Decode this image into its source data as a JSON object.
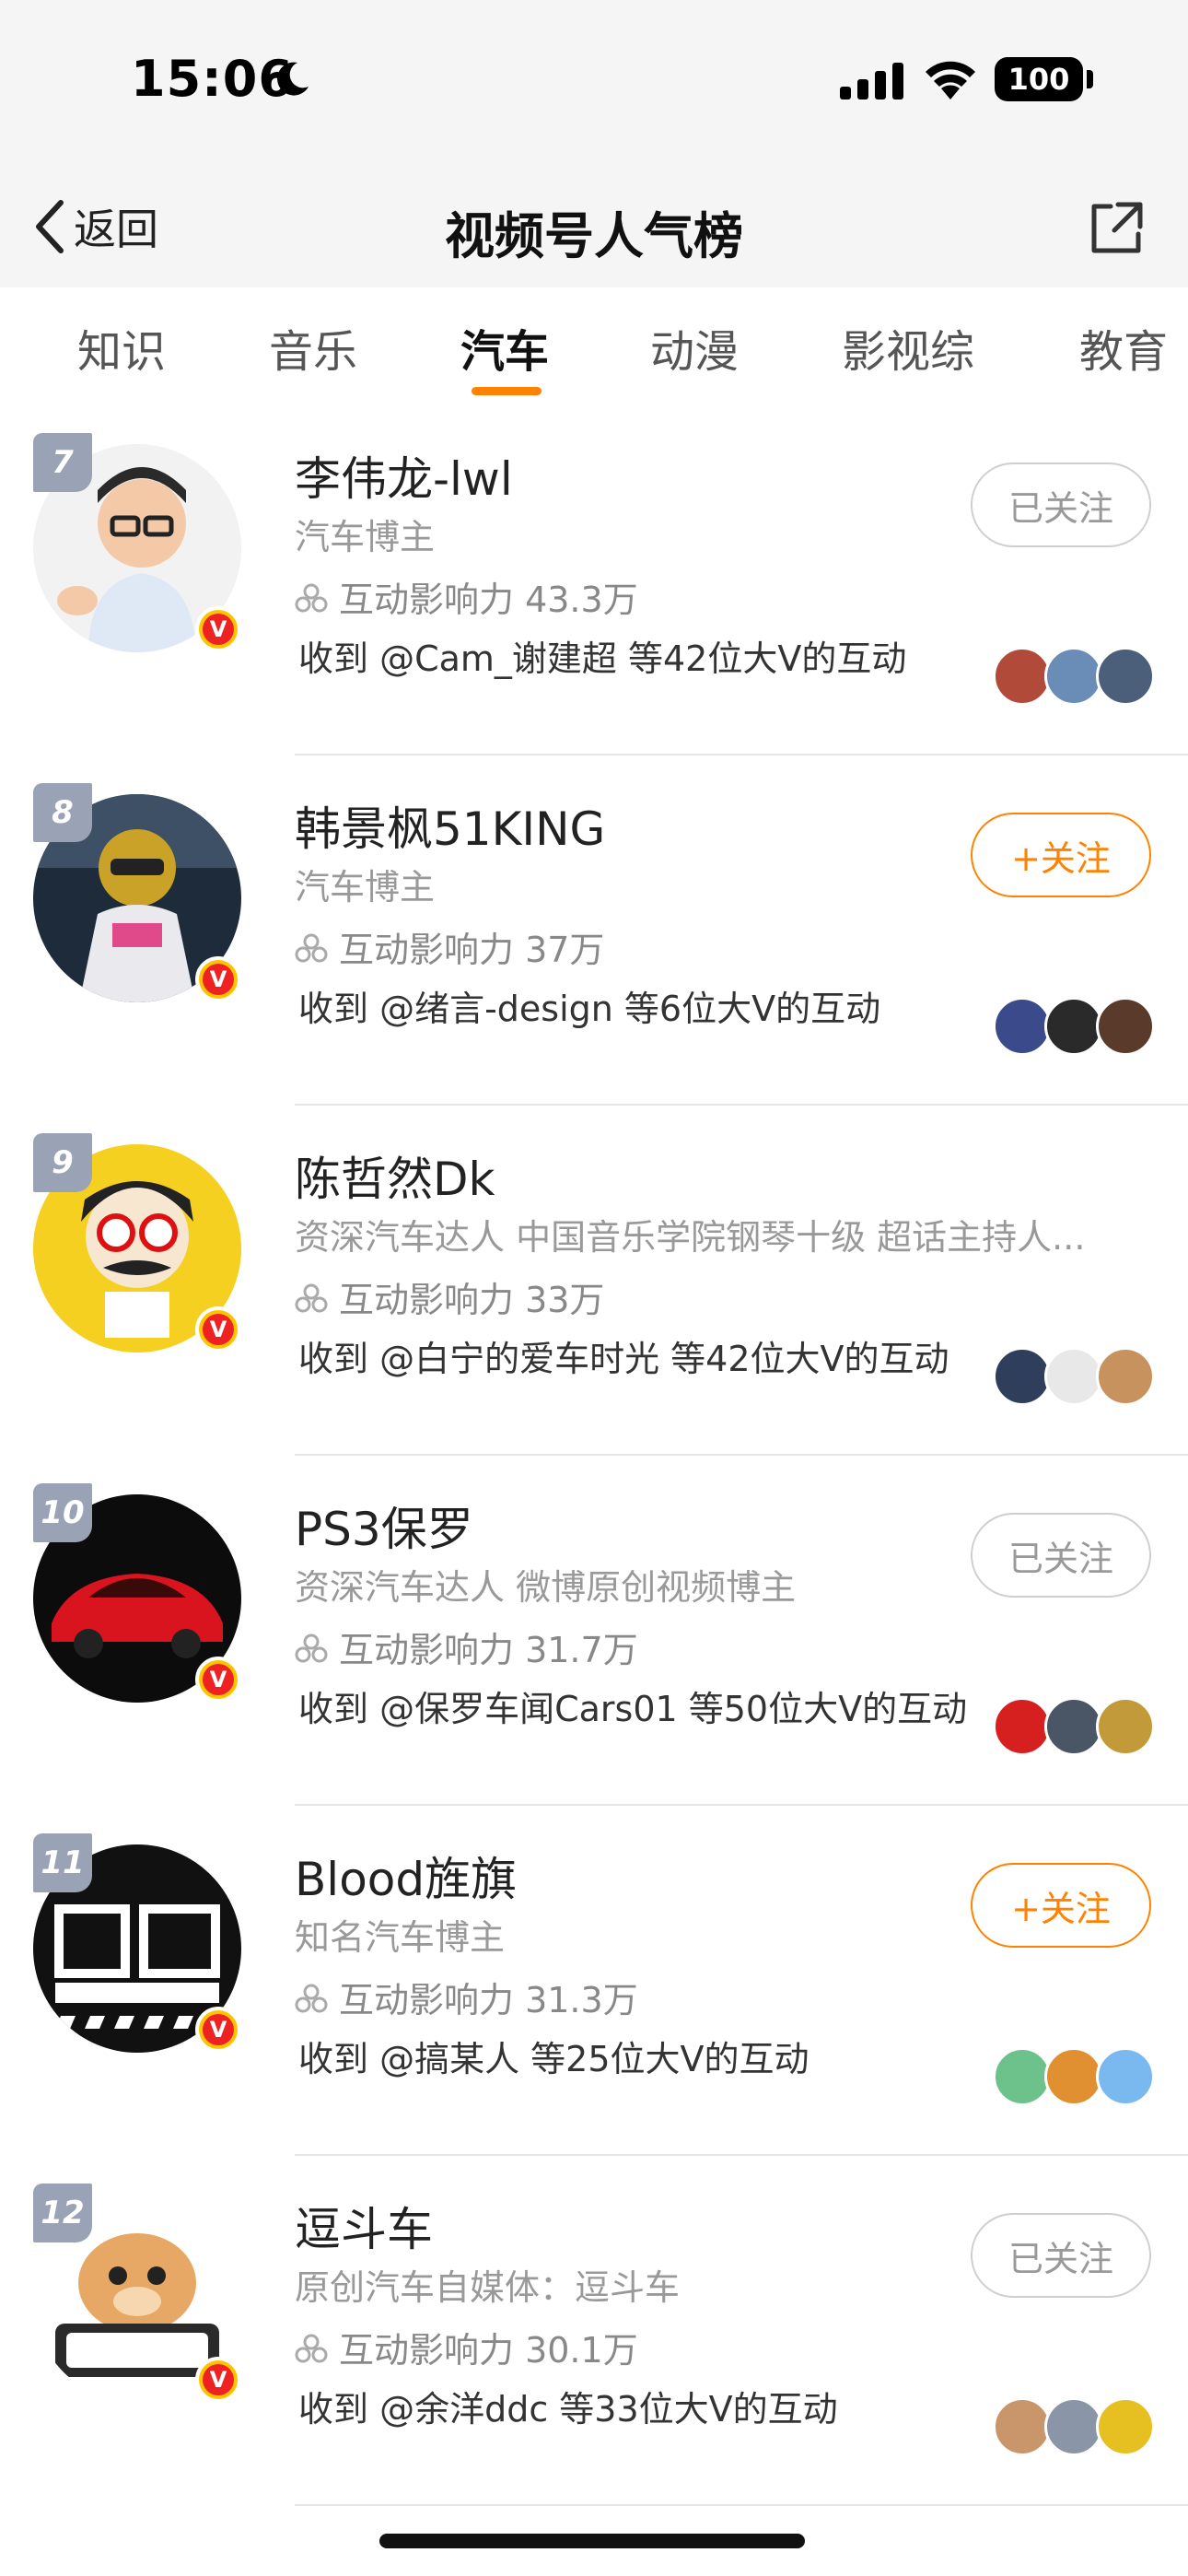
{
  "status_bar": {
    "time": "15:06",
    "battery": "100"
  },
  "nav": {
    "back_label": "返回",
    "title": "视频号人气榜"
  },
  "tabs": [
    {
      "label": "知识",
      "active": false
    },
    {
      "label": "音乐",
      "active": false
    },
    {
      "label": "汽车",
      "active": true
    },
    {
      "label": "动漫",
      "active": false
    },
    {
      "label": "影视综",
      "active": false
    },
    {
      "label": "教育",
      "active": false
    }
  ],
  "colors": {
    "accent": "#ff8200",
    "rank_badge": "#9aa3b6",
    "verified": "#ee2222"
  },
  "rows": [
    {
      "rank": "7",
      "name": "李伟龙-lwl",
      "desc": "汽车博主",
      "influence": "互动影响力 43.3万",
      "received": "收到 @Cam_谢建超 等42位大V的互动",
      "button": "已关注",
      "followed": true
    },
    {
      "rank": "8",
      "name": "韩景枫51KING",
      "desc": "汽车博主",
      "influence": "互动影响力 37万",
      "received": "收到 @绪言-design 等6位大V的互动",
      "button": "+关注",
      "followed": false
    },
    {
      "rank": "9",
      "name": "陈哲然Dk",
      "desc": "资深汽车达人 中国音乐学院钢琴十级 超话主持人...",
      "influence": "互动影响力 33万",
      "received": "收到 @白宁的爱车时光 等42位大V的互动",
      "button": "",
      "followed": null
    },
    {
      "rank": "10",
      "name": "PS3保罗",
      "desc": "资深汽车达人 微博原创视频博主",
      "influence": "互动影响力 31.7万",
      "received": "收到 @保罗车闻Cars01 等50位大V的互动",
      "button": "已关注",
      "followed": true
    },
    {
      "rank": "11",
      "name": "Blood旌旗",
      "desc": "知名汽车博主",
      "influence": "互动影响力 31.3万",
      "received": "收到 @搞某人 等25位大V的互动",
      "button": "+关注",
      "followed": false
    },
    {
      "rank": "12",
      "name": "逗斗车",
      "desc": "原创汽车自媒体：逗斗车",
      "influence": "互动影响力 30.1万",
      "received": "收到 @余洋ddc 等33位大V的互动",
      "button": "已关注",
      "followed": true
    }
  ]
}
